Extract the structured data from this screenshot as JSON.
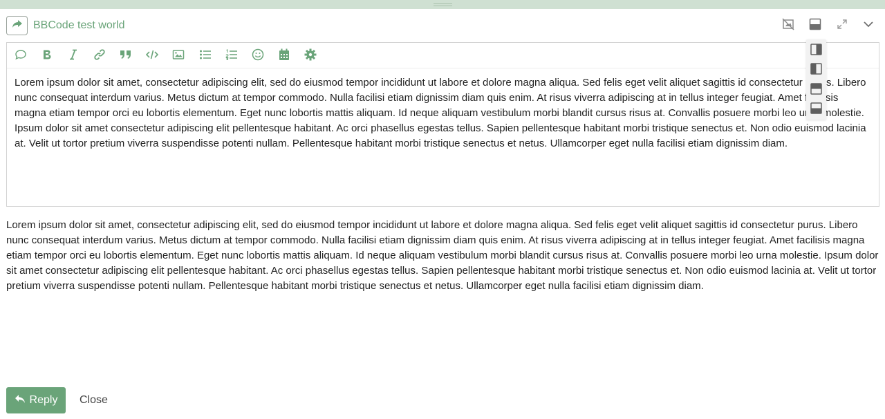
{
  "header": {
    "title": "BBCode test world",
    "share_icon": "share-arrow-icon",
    "controls": [
      "preview-toggle-icon",
      "layout-icon",
      "fullscreen-icon",
      "collapse-chevron-icon"
    ]
  },
  "toolbar": {
    "icons": [
      "speech-bubble-icon",
      "bold-icon",
      "italic-icon",
      "link-icon",
      "quote-icon",
      "code-icon",
      "image-icon",
      "bulleted-list-icon",
      "numbered-list-icon",
      "emoji-icon",
      "calendar-icon",
      "gear-icon"
    ]
  },
  "editor": {
    "text": "Lorem ipsum dolor sit amet, consectetur adipiscing elit, sed do eiusmod tempor incididunt ut labore et dolore magna aliqua. Sed felis eget velit aliquet sagittis id consectetur purus. Libero nunc consequat interdum varius. Metus dictum at tempor commodo. Nulla facilisi etiam dignissim diam quis enim. At risus viverra adipiscing at in tellus integer feugiat. Amet facilisis magna etiam tempor orci eu lobortis elementum. Eget nunc lobortis mattis aliquam. Id neque aliquam vestibulum morbi blandit cursus risus at. Convallis posuere morbi leo urna molestie. Ipsum dolor sit amet consectetur adipiscing elit pellentesque habitant. Ac orci phasellus egestas tellus. Sapien pellentesque habitant morbi tristique senectus et. Non odio euismod lacinia at. Velit ut tortor pretium viverra suspendisse potenti nullam. Pellentesque habitant morbi tristique senectus et netus. Ullamcorper eget nulla facilisi etiam dignissim diam."
  },
  "preview": {
    "text": "Lorem ipsum dolor sit amet, consectetur adipiscing elit, sed do eiusmod tempor incididunt ut labore et dolore magna aliqua. Sed felis eget velit aliquet sagittis id consectetur purus. Libero nunc consequat interdum varius. Metus dictum at tempor commodo. Nulla facilisi etiam dignissim diam quis enim. At risus viverra adipiscing at in tellus integer feugiat. Amet facilisis magna etiam tempor orci eu lobortis elementum. Eget nunc lobortis mattis aliquam. Id neque aliquam vestibulum morbi blandit cursus risus at. Convallis posuere morbi leo urna molestie. Ipsum dolor sit amet consectetur adipiscing elit pellentesque habitant. Ac orci phasellus egestas tellus. Sapien pellentesque habitant morbi tristique senectus et. Non odio euismod lacinia at. Velit ut tortor pretium viverra suspendisse potenti nullam. Pellentesque habitant morbi tristique senectus et netus. Ullamcorper eget nulla facilisi etiam dignissim diam."
  },
  "layout_menu": {
    "options": [
      "layout-right-panel-icon",
      "layout-left-panel-icon",
      "layout-top-panel-icon",
      "layout-bottom-panel-icon"
    ]
  },
  "footer": {
    "reply_label": "Reply",
    "close_label": "Close"
  },
  "colors": {
    "accent": "#6aa479",
    "strip": "#cfe0d2",
    "icon": "#6aa479"
  }
}
